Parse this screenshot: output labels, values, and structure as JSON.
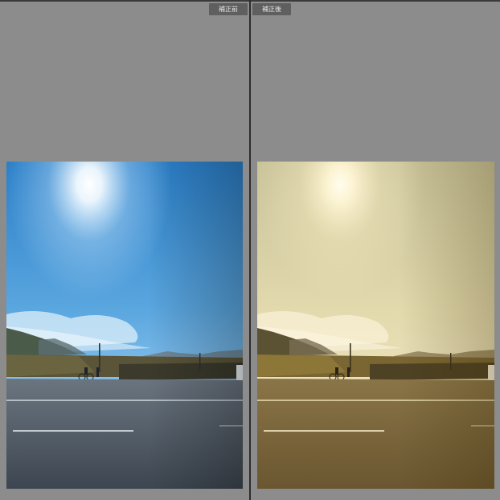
{
  "labels": {
    "before": "補正前",
    "after": "補正後"
  },
  "colors": {
    "workspace": "#8c8c8c",
    "label_bg": "#5f5f5f",
    "divider": "#2c2c2c"
  },
  "icons": {
    "before_photo": "photo-image",
    "after_photo": "photo-image"
  }
}
